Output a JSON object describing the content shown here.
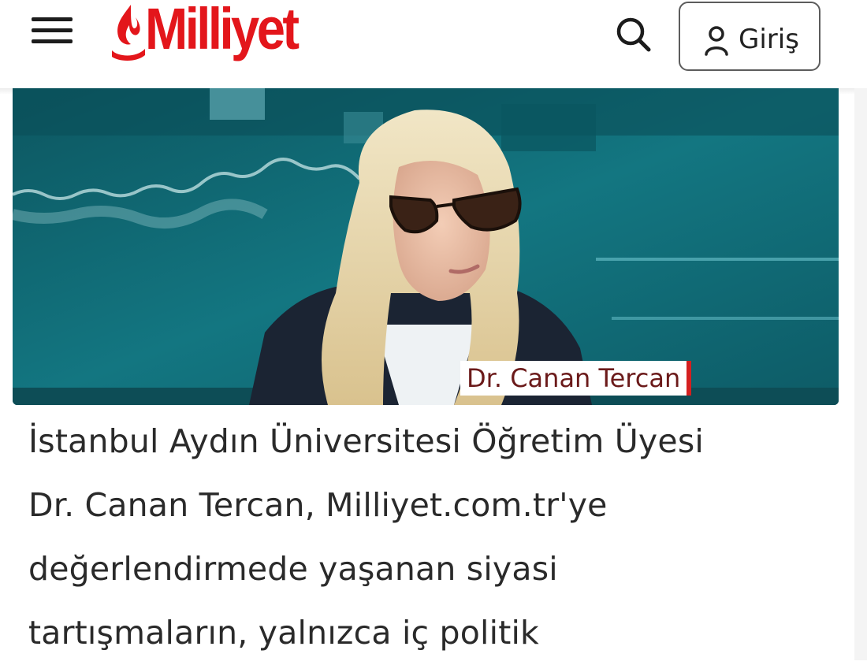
{
  "header": {
    "logo_text": "Milliyet",
    "search_icon": "search-icon",
    "login_label": "Giriş",
    "menu_icon": "hamburger-menu-icon",
    "brand_color": "#e3161b"
  },
  "hero": {
    "caption": "Dr. Canan Tercan",
    "dominant_color": "#0f5e68"
  },
  "article": {
    "lead_lines": [
      "İstanbul Aydın Üniversitesi Öğretim Üyesi",
      "Dr. Canan Tercan, Milliyet.com.tr'ye",
      "değerlendirmede yaşanan siyasi",
      "tartışmaların, yalnızca iç politik"
    ]
  }
}
